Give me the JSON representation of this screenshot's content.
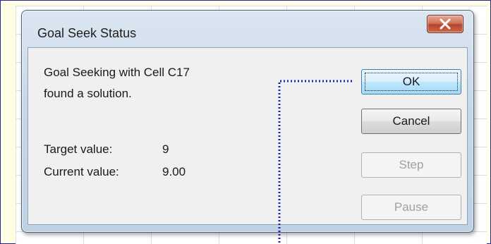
{
  "dialog": {
    "title": "Goal Seek Status",
    "close_label": "X",
    "message_line1": "Goal Seeking with Cell C17",
    "message_line2": "found a solution.",
    "target_label": "Target value:",
    "target_value": "9",
    "current_label": "Current value:",
    "current_value": "9.00"
  },
  "buttons": {
    "ok": "OK",
    "cancel": "Cancel",
    "step": "Step",
    "pause": "Pause"
  },
  "colors": {
    "background": "#fffde3",
    "annotation_line": "#1a22b8",
    "close_button": "#c8573d",
    "ok_button": "#bee6fd"
  },
  "icons": {
    "close": "close-icon"
  }
}
